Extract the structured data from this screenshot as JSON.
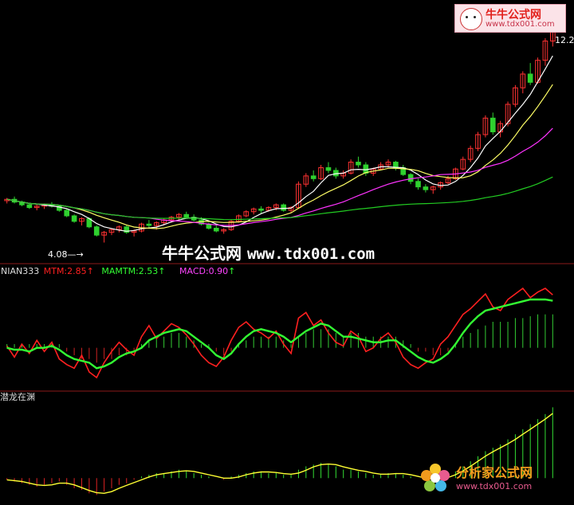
{
  "chart_data": [
    {
      "type": "candlestick",
      "panel": "price",
      "annotations": {
        "low_label": "4.08",
        "high_label": "12.2"
      },
      "price_range": [
        3.4,
        12.6
      ],
      "candles": [
        [
          5.6,
          5.7,
          5.5,
          5.65
        ],
        [
          5.65,
          5.75,
          5.5,
          5.55
        ],
        [
          5.55,
          5.6,
          5.4,
          5.45
        ],
        [
          5.45,
          5.5,
          5.3,
          5.35
        ],
        [
          5.35,
          5.45,
          5.25,
          5.4
        ],
        [
          5.4,
          5.5,
          5.3,
          5.45
        ],
        [
          5.45,
          5.55,
          5.35,
          5.4
        ],
        [
          5.4,
          5.45,
          5.2,
          5.25
        ],
        [
          5.25,
          5.3,
          5.0,
          5.05
        ],
        [
          5.05,
          5.1,
          4.8,
          4.85
        ],
        [
          4.85,
          5.0,
          4.7,
          4.95
        ],
        [
          4.95,
          5.0,
          4.6,
          4.65
        ],
        [
          4.65,
          4.7,
          4.3,
          4.35
        ],
        [
          4.35,
          4.5,
          4.08,
          4.45
        ],
        [
          4.45,
          4.6,
          4.35,
          4.55
        ],
        [
          4.55,
          4.7,
          4.45,
          4.65
        ],
        [
          4.65,
          4.7,
          4.4,
          4.45
        ],
        [
          4.45,
          4.55,
          4.3,
          4.5
        ],
        [
          4.5,
          4.8,
          4.45,
          4.75
        ],
        [
          4.75,
          4.9,
          4.6,
          4.7
        ],
        [
          4.7,
          4.85,
          4.55,
          4.8
        ],
        [
          4.8,
          4.95,
          4.7,
          4.9
        ],
        [
          4.9,
          5.05,
          4.8,
          5.0
        ],
        [
          5.0,
          5.15,
          4.9,
          5.1
        ],
        [
          5.1,
          5.2,
          4.95,
          5.0
        ],
        [
          5.0,
          5.1,
          4.85,
          4.9
        ],
        [
          4.9,
          5.0,
          4.7,
          4.75
        ],
        [
          4.75,
          4.8,
          4.55,
          4.6
        ],
        [
          4.6,
          4.7,
          4.45,
          4.5
        ],
        [
          4.5,
          4.6,
          4.4,
          4.55
        ],
        [
          4.55,
          4.9,
          4.5,
          4.85
        ],
        [
          4.85,
          5.1,
          4.8,
          5.05
        ],
        [
          5.05,
          5.25,
          5.0,
          5.2
        ],
        [
          5.2,
          5.35,
          5.1,
          5.3
        ],
        [
          5.3,
          5.4,
          5.15,
          5.25
        ],
        [
          5.25,
          5.4,
          5.2,
          5.35
        ],
        [
          5.35,
          5.5,
          5.25,
          5.45
        ],
        [
          5.45,
          5.5,
          5.2,
          5.25
        ],
        [
          5.25,
          5.4,
          5.15,
          5.35
        ],
        [
          5.35,
          6.3,
          5.3,
          6.2
        ],
        [
          6.2,
          6.6,
          6.1,
          6.5
        ],
        [
          6.5,
          6.7,
          6.3,
          6.4
        ],
        [
          6.4,
          6.9,
          6.35,
          6.8
        ],
        [
          6.8,
          7.0,
          6.6,
          6.7
        ],
        [
          6.7,
          6.8,
          6.4,
          6.5
        ],
        [
          6.5,
          6.7,
          6.4,
          6.6
        ],
        [
          6.6,
          7.1,
          6.55,
          7.0
        ],
        [
          7.0,
          7.2,
          6.8,
          6.9
        ],
        [
          6.9,
          7.0,
          6.5,
          6.6
        ],
        [
          6.6,
          6.8,
          6.5,
          6.75
        ],
        [
          6.75,
          7.0,
          6.7,
          6.9
        ],
        [
          6.9,
          7.1,
          6.8,
          7.0
        ],
        [
          7.0,
          7.05,
          6.7,
          6.8
        ],
        [
          6.8,
          6.9,
          6.5,
          6.55
        ],
        [
          6.55,
          6.6,
          6.2,
          6.3
        ],
        [
          6.3,
          6.4,
          6.0,
          6.1
        ],
        [
          6.1,
          6.2,
          5.9,
          6.0
        ],
        [
          6.0,
          6.15,
          5.85,
          6.1
        ],
        [
          6.1,
          6.3,
          6.0,
          6.25
        ],
        [
          6.25,
          6.5,
          6.2,
          6.4
        ],
        [
          6.4,
          6.8,
          6.35,
          6.75
        ],
        [
          6.75,
          7.2,
          6.7,
          7.1
        ],
        [
          7.1,
          7.6,
          7.0,
          7.5
        ],
        [
          7.5,
          8.1,
          7.4,
          8.0
        ],
        [
          8.0,
          8.7,
          7.9,
          8.6
        ],
        [
          8.6,
          8.8,
          8.0,
          8.1
        ],
        [
          8.1,
          8.5,
          7.9,
          8.4
        ],
        [
          8.4,
          9.2,
          8.3,
          9.1
        ],
        [
          9.1,
          9.8,
          9.0,
          9.7
        ],
        [
          9.7,
          10.3,
          9.5,
          10.2
        ],
        [
          10.2,
          10.6,
          9.8,
          9.9
        ],
        [
          9.9,
          10.8,
          9.85,
          10.7
        ],
        [
          10.7,
          11.5,
          10.5,
          11.4
        ],
        [
          11.4,
          12.2,
          11.2,
          12.1
        ]
      ],
      "moving_averages": [
        {
          "color": "#ffffff",
          "period": 5
        },
        {
          "color": "#ffff66",
          "period": 10
        },
        {
          "color": "#ff33ff",
          "period": 20
        },
        {
          "color": "#22cc22",
          "period": 60
        }
      ]
    },
    {
      "type": "line",
      "panel": "indicator",
      "title": "NIAN333",
      "series_labels": [
        {
          "text": "MTM:2.85",
          "color": "#ff2020"
        },
        {
          "text": "MAMTM:2.53",
          "color": "#33ff33"
        },
        {
          "text": "MACD:0.90",
          "color": "#ff44ff"
        }
      ],
      "mtm": [
        0.1,
        -0.5,
        0.2,
        -0.3,
        0.4,
        -0.2,
        0.3,
        -0.6,
        -0.9,
        -1.1,
        -0.4,
        -1.3,
        -1.6,
        -0.8,
        -0.2,
        0.3,
        -0.1,
        -0.4,
        0.6,
        1.2,
        0.5,
        0.9,
        1.3,
        1.1,
        0.7,
        0.2,
        -0.4,
        -0.8,
        -1.0,
        -0.5,
        0.4,
        1.1,
        1.4,
        1.0,
        0.8,
        0.5,
        0.9,
        0.2,
        -0.3,
        1.6,
        1.9,
        1.2,
        1.5,
        0.8,
        0.3,
        0.1,
        0.9,
        0.6,
        -0.2,
        0.0,
        0.5,
        0.8,
        0.3,
        -0.5,
        -0.9,
        -1.1,
        -0.8,
        -0.6,
        0.2,
        0.6,
        1.2,
        1.8,
        2.1,
        2.5,
        2.9,
        2.2,
        2.0,
        2.6,
        2.9,
        3.2,
        2.7,
        3.0,
        3.2,
        2.85
      ],
      "mamtm": [
        0.0,
        -0.1,
        -0.1,
        -0.2,
        0.0,
        0.0,
        0.1,
        -0.1,
        -0.4,
        -0.6,
        -0.7,
        -0.8,
        -1.1,
        -1.0,
        -0.8,
        -0.5,
        -0.3,
        -0.2,
        0.0,
        0.4,
        0.6,
        0.8,
        0.9,
        1.0,
        0.9,
        0.6,
        0.3,
        0.0,
        -0.4,
        -0.6,
        -0.3,
        0.2,
        0.6,
        0.9,
        1.0,
        0.9,
        0.8,
        0.6,
        0.3,
        0.6,
        0.9,
        1.1,
        1.3,
        1.2,
        0.9,
        0.6,
        0.6,
        0.5,
        0.4,
        0.3,
        0.3,
        0.4,
        0.4,
        0.1,
        -0.2,
        -0.5,
        -0.7,
        -0.8,
        -0.6,
        -0.3,
        0.2,
        0.8,
        1.3,
        1.7,
        2.0,
        2.1,
        2.2,
        2.3,
        2.4,
        2.5,
        2.6,
        2.6,
        2.6,
        2.53
      ],
      "macd": [
        0.1,
        0.1,
        0.1,
        0.1,
        0.1,
        0.1,
        0.1,
        0.1,
        -0.1,
        -0.2,
        -0.3,
        -0.3,
        -0.4,
        -0.3,
        -0.3,
        -0.2,
        -0.2,
        -0.1,
        0.1,
        0.2,
        0.3,
        0.3,
        0.4,
        0.4,
        0.3,
        0.2,
        0.1,
        0.1,
        -0.1,
        -0.2,
        -0.1,
        0.1,
        0.2,
        0.3,
        0.3,
        0.3,
        0.3,
        0.2,
        0.1,
        0.3,
        0.4,
        0.5,
        0.5,
        0.5,
        0.4,
        0.3,
        0.4,
        0.4,
        0.3,
        0.3,
        0.3,
        0.3,
        0.3,
        0.2,
        0.1,
        -0.1,
        -0.1,
        -0.2,
        -0.2,
        -0.1,
        0.1,
        0.3,
        0.4,
        0.5,
        0.6,
        0.7,
        0.7,
        0.7,
        0.8,
        0.8,
        0.85,
        0.9,
        0.9,
        0.9
      ],
      "range": [
        -2.2,
        3.8
      ]
    },
    {
      "type": "bar",
      "panel": "indicator-2",
      "title": "潜龙在渊",
      "values": [
        -0.1,
        -0.2,
        -0.3,
        -0.4,
        -0.5,
        -0.4,
        -0.3,
        -0.2,
        -0.4,
        -0.6,
        -0.7,
        -0.9,
        -1.0,
        -0.8,
        -0.6,
        -0.4,
        -0.3,
        -0.1,
        0.1,
        0.2,
        0.3,
        0.3,
        0.4,
        0.5,
        0.4,
        0.3,
        0.2,
        0.1,
        0.0,
        -0.1,
        0.1,
        0.2,
        0.3,
        0.4,
        0.4,
        0.3,
        0.3,
        0.2,
        0.2,
        0.5,
        0.7,
        0.8,
        0.9,
        0.8,
        0.7,
        0.5,
        0.5,
        0.4,
        0.3,
        0.2,
        0.2,
        0.3,
        0.3,
        0.2,
        0.1,
        0.0,
        -0.1,
        -0.1,
        0.0,
        0.2,
        0.4,
        0.7,
        1.0,
        1.3,
        1.6,
        1.8,
        2.0,
        2.3,
        2.6,
        2.9,
        3.2,
        3.5,
        3.8,
        4.2
      ],
      "range": [
        -1.5,
        4.5
      ]
    }
  ],
  "watermark": {
    "site_name": "牛牛公式网",
    "url": "www.tdx001.com"
  },
  "logo_top": {
    "name": "牛牛公式网",
    "url": "www.tdx001.com"
  },
  "logo_bottom": {
    "name": "分析家公式网",
    "url": "www.tdx001.com"
  }
}
